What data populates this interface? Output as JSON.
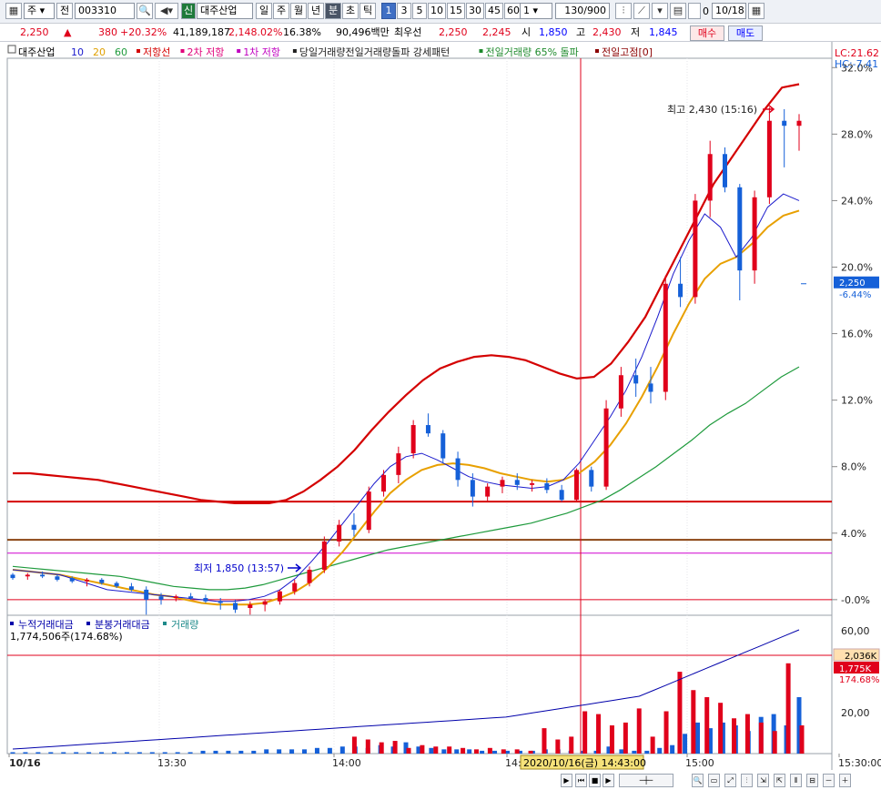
{
  "toolbar": {
    "type_select": "주",
    "prev_label": "전",
    "code": "003310",
    "badge": "신",
    "stock_name": "대주산업",
    "periods": [
      "일",
      "주",
      "월",
      "년",
      "분",
      "초",
      "틱"
    ],
    "selected_period": "분",
    "intervals": [
      "1",
      "3",
      "5",
      "10",
      "15",
      "30",
      "45",
      "60"
    ],
    "selected_interval": "1",
    "interval_value": "1",
    "count": "130",
    "count_max": "/900",
    "date_flag": "0",
    "date": "10/18"
  },
  "quote": {
    "price": "2,250",
    "arrow": "▲",
    "change": "380",
    "change_rate": "+20.32%",
    "volume": "41,189,187",
    "volume_rate": "2,148.02%",
    "turnover": "16.38%",
    "amount": "90,496백만",
    "ask_label": "최우선",
    "ask": "2,250",
    "bid": "2,245",
    "open_label": "시",
    "open": "1,850",
    "high_label": "고",
    "high": "2,430",
    "low_label": "저",
    "low": "1,845",
    "buy_label": "매수",
    "sell_label": "매도"
  },
  "legend": {
    "name": "대주산업",
    "ma": [
      {
        "label": "10",
        "color": "#1a1acc"
      },
      {
        "label": "20",
        "color": "#e0a000"
      },
      {
        "label": "60",
        "color": "#1e9a3c"
      }
    ],
    "items": [
      {
        "label": "저항선",
        "color": "#d40000"
      },
      {
        "label": "2차 저항",
        "color": "#e0007a"
      },
      {
        "label": "1차 저항",
        "color": "#c000c0"
      },
      {
        "label": "당일거래량전일거래량돌파 강세패턴",
        "color": "#202020"
      },
      {
        "label": "전일거래량 65% 돌파",
        "color": "#1e8a2c"
      },
      {
        "label": "전일고점[0]",
        "color": "#8b0000"
      }
    ],
    "lc": "LC:21.62",
    "hc": "HC:-7.41"
  },
  "volume_legend": {
    "items": [
      {
        "label": "누적거래대금",
        "color": "#0000aa"
      },
      {
        "label": "분봉거래대금",
        "color": "#0000aa"
      },
      {
        "label": "거래량",
        "color": "#1e8a8a"
      }
    ],
    "value": "1,774,506주(174.68%)"
  },
  "colors": {
    "up": "#e0001b",
    "down": "#1560d8",
    "resistance": "#d40000",
    "prev_high": "#8b4513",
    "support2": "#d000d0",
    "ma10": "#1a1acc",
    "ma20": "#e8a000",
    "ma60": "#1e9a3c",
    "cursor": "#e0001b"
  },
  "chart_data": {
    "type": "candlestick",
    "yticks": [
      "32.0%",
      "28.0%",
      "24.0%",
      "20.0%",
      "16.0%",
      "12.0%",
      "8.0%",
      "4.0%",
      "-0.0%"
    ],
    "yrange_pct": [
      -0.5,
      33
    ],
    "base_price": 1870,
    "xticks": [
      "10/16",
      "13:30",
      "14:00",
      "14:30",
      "15:00",
      "15:30:00"
    ],
    "cursor_label": "2020/10/16(금) 14:43:00",
    "last_price_label": "2,250",
    "last_pct_label": "-6.44%",
    "high_annotation": "최고 2,430 (15:16)",
    "low_annotation": "최저 1,850 (13:57)",
    "hlines_pct": {
      "resistance": 5.9,
      "prev_high": 3.6,
      "line_2nd": 2.8,
      "base": 0.0
    },
    "upper_band": [
      7.6,
      7.6,
      7.5,
      7.4,
      7.3,
      7.2,
      7.0,
      6.8,
      6.6,
      6.4,
      6.2,
      6.0,
      5.9,
      5.8,
      5.8,
      5.8,
      6.0,
      6.5,
      7.2,
      8.0,
      9.0,
      10.2,
      11.3,
      12.3,
      13.2,
      13.9,
      14.3,
      14.6,
      14.7,
      14.6,
      14.4,
      14.0,
      13.6,
      13.3,
      13.4,
      14.2,
      15.5,
      17.0,
      19.0,
      21.0,
      23.0,
      25.0,
      26.5,
      28.0,
      29.5,
      30.8,
      31.0
    ],
    "ma10": [
      1.8,
      1.7,
      1.6,
      1.5,
      1.2,
      0.9,
      0.6,
      0.5,
      0.4,
      0.3,
      0.2,
      0.1,
      0.0,
      -0.1,
      -0.1,
      0.0,
      0.2,
      0.6,
      1.3,
      2.3,
      3.4,
      4.6,
      5.8,
      7.0,
      8.0,
      8.6,
      8.8,
      8.4,
      7.9,
      7.4,
      7.1,
      6.9,
      6.8,
      6.7,
      6.8,
      7.2,
      8.2,
      9.6,
      11.0,
      12.6,
      14.6,
      17.0,
      19.6,
      21.6,
      23.2,
      22.4,
      20.6,
      21.8,
      23.6,
      24.4,
      24.0
    ],
    "ma20": [
      1.8,
      1.7,
      1.6,
      1.5,
      1.3,
      1.1,
      0.9,
      0.7,
      0.5,
      0.3,
      0.2,
      0.0,
      -0.2,
      -0.3,
      -0.3,
      -0.3,
      -0.2,
      0.1,
      0.5,
      1.1,
      1.9,
      2.9,
      4.1,
      5.3,
      6.4,
      7.2,
      7.8,
      8.1,
      8.2,
      8.1,
      7.9,
      7.6,
      7.4,
      7.2,
      7.1,
      7.2,
      7.6,
      8.3,
      9.3,
      10.6,
      12.2,
      14.0,
      16.0,
      17.8,
      19.3,
      20.2,
      20.6,
      21.4,
      22.4,
      23.1,
      23.4
    ],
    "ma60": [
      2.0,
      1.9,
      1.8,
      1.7,
      1.6,
      1.5,
      1.4,
      1.2,
      1.0,
      0.8,
      0.7,
      0.6,
      0.6,
      0.7,
      0.9,
      1.2,
      1.5,
      1.8,
      2.1,
      2.4,
      2.7,
      3.0,
      3.2,
      3.4,
      3.6,
      3.8,
      4.0,
      4.2,
      4.4,
      4.6,
      4.9,
      5.2,
      5.6,
      6.0,
      6.6,
      7.3,
      8.0,
      8.8,
      9.6,
      10.5,
      11.2,
      11.8,
      12.6,
      13.4,
      14.0
    ],
    "candles": [
      [
        1.5,
        1.6,
        1.2,
        1.3
      ],
      [
        1.4,
        1.6,
        1.2,
        1.5
      ],
      [
        1.5,
        1.7,
        1.3,
        1.4
      ],
      [
        1.4,
        1.5,
        1.1,
        1.2
      ],
      [
        1.3,
        1.4,
        1.0,
        1.1
      ],
      [
        1.1,
        1.3,
        0.8,
        1.2
      ],
      [
        1.2,
        1.3,
        0.9,
        1.0
      ],
      [
        1.0,
        1.1,
        0.7,
        0.8
      ],
      [
        0.8,
        1.0,
        0.5,
        0.6
      ],
      [
        0.6,
        0.8,
        -0.9,
        0.0
      ],
      [
        0.2,
        0.4,
        -0.3,
        0.0
      ],
      [
        0.1,
        0.3,
        -0.1,
        0.2
      ],
      [
        0.2,
        0.4,
        0.0,
        0.1
      ],
      [
        0.1,
        0.3,
        -0.2,
        -0.1
      ],
      [
        -0.1,
        0.1,
        -0.6,
        -0.2
      ],
      [
        -0.2,
        0.0,
        -0.8,
        -0.6
      ],
      [
        -0.5,
        -0.1,
        -0.9,
        -0.3
      ],
      [
        -0.3,
        0.0,
        -0.7,
        -0.1
      ],
      [
        -0.1,
        0.6,
        -0.3,
        0.5
      ],
      [
        0.5,
        1.2,
        0.3,
        1.0
      ],
      [
        1.0,
        2.0,
        0.8,
        1.8
      ],
      [
        1.8,
        3.8,
        1.6,
        3.5
      ],
      [
        3.5,
        4.8,
        3.2,
        4.5
      ],
      [
        4.5,
        5.2,
        3.8,
        4.2
      ],
      [
        4.2,
        6.8,
        4.0,
        6.5
      ],
      [
        6.5,
        7.8,
        6.2,
        7.5
      ],
      [
        7.5,
        9.2,
        7.0,
        8.8
      ],
      [
        8.8,
        10.8,
        8.5,
        10.5
      ],
      [
        10.5,
        11.2,
        9.8,
        10.0
      ],
      [
        10.0,
        10.2,
        8.2,
        8.5
      ],
      [
        8.5,
        8.9,
        6.8,
        7.2
      ],
      [
        7.2,
        7.6,
        5.6,
        6.2
      ],
      [
        6.2,
        7.0,
        5.9,
        6.8
      ],
      [
        6.8,
        7.4,
        6.4,
        7.2
      ],
      [
        7.2,
        7.6,
        6.6,
        6.9
      ],
      [
        6.9,
        7.2,
        6.5,
        7.0
      ],
      [
        7.0,
        7.3,
        6.4,
        6.6
      ],
      [
        6.6,
        6.9,
        5.9,
        6.0
      ],
      [
        6.0,
        7.9,
        5.9,
        7.8
      ],
      [
        7.8,
        8.0,
        6.5,
        6.8
      ],
      [
        6.8,
        12.0,
        6.6,
        11.5
      ],
      [
        11.5,
        14.0,
        11.0,
        13.5
      ],
      [
        13.5,
        14.5,
        12.2,
        13.0
      ],
      [
        13.0,
        14.0,
        11.8,
        12.5
      ],
      [
        12.5,
        19.5,
        12.0,
        19.0
      ],
      [
        19.0,
        20.6,
        17.6,
        18.2
      ],
      [
        18.2,
        24.4,
        17.8,
        24.0
      ],
      [
        24.0,
        27.6,
        23.0,
        26.8
      ],
      [
        26.8,
        27.2,
        24.5,
        24.8
      ],
      [
        24.8,
        25.0,
        18.0,
        19.8
      ],
      [
        19.8,
        24.6,
        19.0,
        24.2
      ],
      [
        24.2,
        29.6,
        23.8,
        28.8
      ],
      [
        28.8,
        29.5,
        26.0,
        28.5
      ],
      [
        28.5,
        29.2,
        27.0,
        28.8
      ]
    ],
    "volume_axis": [
      "60,00",
      "20,00"
    ],
    "volume_labels": {
      "v1": "2,036K",
      "v2": "1,775K",
      "v3": "174.68%"
    },
    "volume_up": [
      0,
      0,
      0,
      0,
      0,
      0,
      0,
      0,
      0,
      0,
      0,
      0,
      0,
      0,
      0,
      0,
      0,
      0,
      0,
      0,
      0,
      0,
      0,
      0,
      0,
      12,
      10,
      8,
      9,
      4,
      6,
      5,
      5,
      4,
      3,
      4,
      3,
      3,
      2,
      18,
      10,
      12,
      30,
      28,
      20,
      22,
      32,
      12,
      30,
      58,
      45,
      40,
      36,
      25,
      28,
      22,
      16,
      64,
      20
    ],
    "volume_dn": [
      1,
      1,
      1,
      1,
      1,
      1,
      1,
      1,
      1,
      1,
      1,
      1,
      1,
      1,
      1,
      2,
      2,
      2,
      2,
      2,
      3,
      3,
      3,
      3,
      4,
      4,
      5,
      5,
      4,
      6,
      5,
      8,
      5,
      4,
      3,
      3,
      3,
      2,
      2,
      2,
      2,
      2,
      3,
      3,
      2,
      2,
      2,
      5,
      3,
      2,
      2,
      4,
      6,
      14,
      22,
      18,
      22,
      20,
      16,
      26,
      28,
      20,
      40
    ]
  }
}
